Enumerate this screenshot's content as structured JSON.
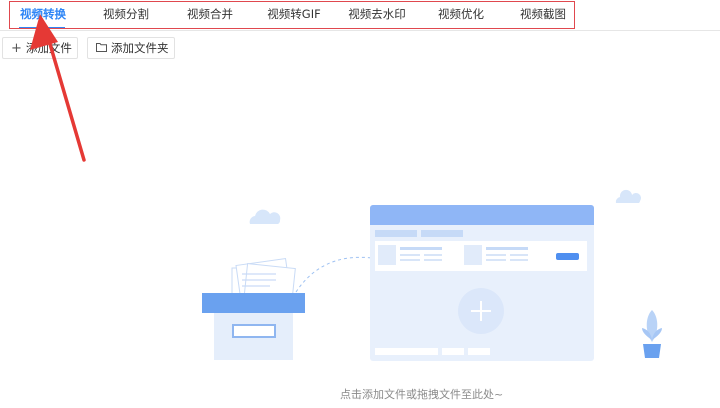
{
  "tabs": [
    {
      "label": "视频转换",
      "active": true
    },
    {
      "label": "视频分割",
      "active": false
    },
    {
      "label": "视频合并",
      "active": false
    },
    {
      "label": "视频转GIF",
      "active": false
    },
    {
      "label": "视频去水印",
      "active": false
    },
    {
      "label": "视频优化",
      "active": false
    },
    {
      "label": "视频截图",
      "active": false
    }
  ],
  "toolbar": {
    "add_file_label": "添加文件",
    "add_folder_label": "添加文件夹",
    "add_file_icon": "plus-icon",
    "add_folder_icon": "folder-icon"
  },
  "empty_state": {
    "hint": "点击添加文件或拖拽文件至此处~"
  },
  "colors": {
    "accent": "#2f86f6",
    "highlight_frame": "#e0484e",
    "annotation_arrow": "#e53935"
  }
}
